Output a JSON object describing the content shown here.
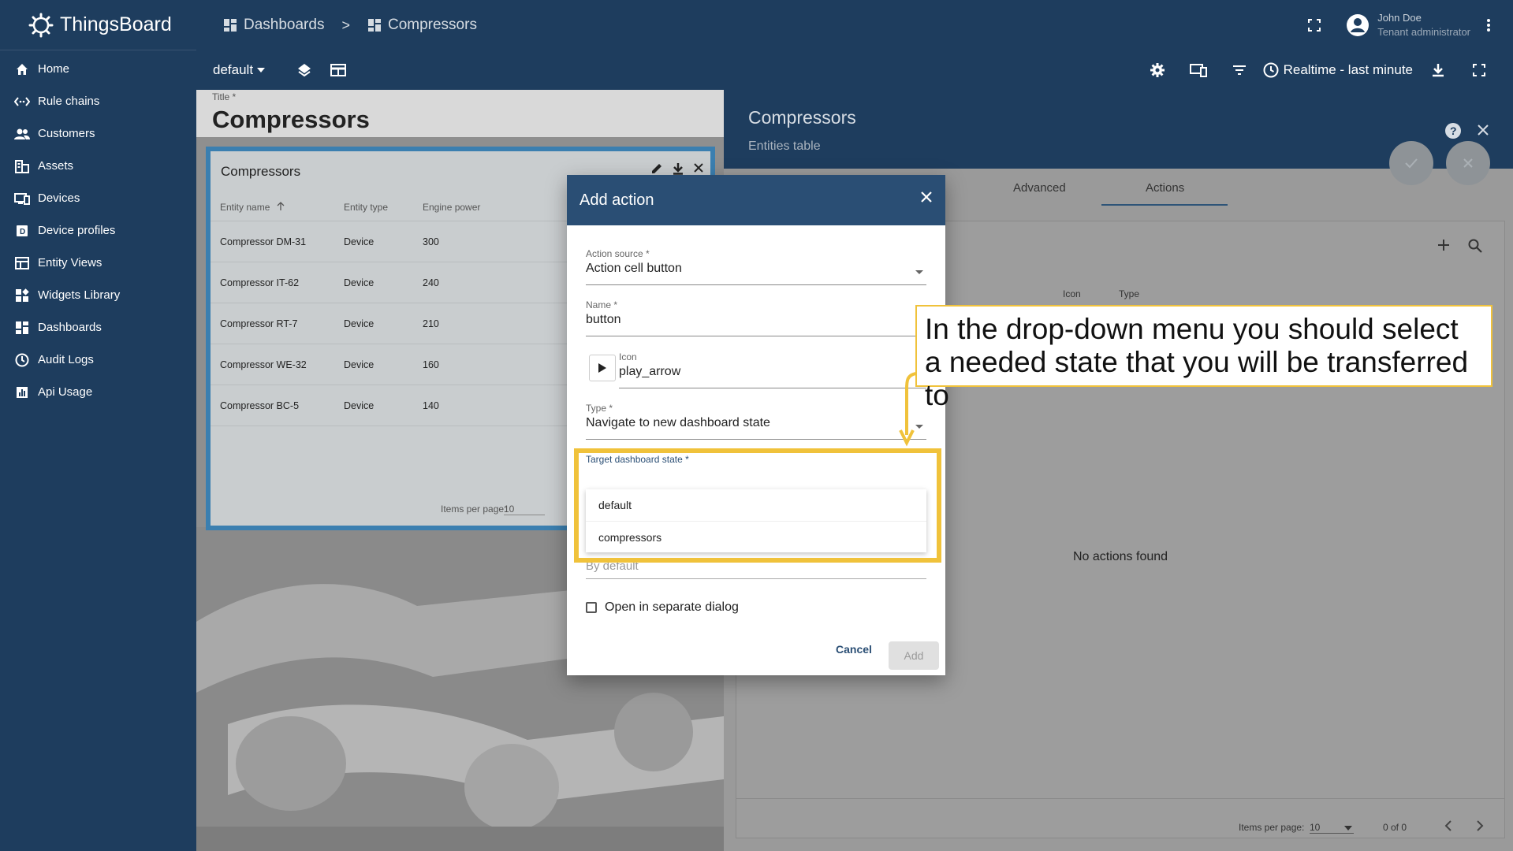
{
  "app": {
    "name": "ThingsBoard"
  },
  "sidebar": {
    "items": [
      {
        "label": "Home",
        "icon": "home-icon"
      },
      {
        "label": "Rule chains",
        "icon": "rule-chains-icon"
      },
      {
        "label": "Customers",
        "icon": "customers-icon"
      },
      {
        "label": "Assets",
        "icon": "assets-icon"
      },
      {
        "label": "Devices",
        "icon": "devices-icon"
      },
      {
        "label": "Device profiles",
        "icon": "device-profiles-icon"
      },
      {
        "label": "Entity Views",
        "icon": "entity-views-icon"
      },
      {
        "label": "Widgets Library",
        "icon": "widgets-library-icon"
      },
      {
        "label": "Dashboards",
        "icon": "dashboards-icon"
      },
      {
        "label": "Audit Logs",
        "icon": "audit-logs-icon"
      },
      {
        "label": "Api Usage",
        "icon": "api-usage-icon"
      }
    ]
  },
  "topbar": {
    "breadcrumb": [
      "Dashboards",
      "Compressors"
    ],
    "separator": ">",
    "user": {
      "name": "John Doe",
      "role": "Tenant administrator"
    }
  },
  "toolbar": {
    "state": "default",
    "timewindow": "Realtime - last minute"
  },
  "dashboard": {
    "title_label": "Title *",
    "title": "Compressors",
    "widget": {
      "title": "Compressors",
      "columns": [
        "Entity name",
        "Entity type",
        "Engine power"
      ],
      "rows": [
        {
          "name": "Compressor DM-31",
          "type": "Device",
          "power": "300"
        },
        {
          "name": "Compressor IT-62",
          "type": "Device",
          "power": "240"
        },
        {
          "name": "Compressor RT-7",
          "type": "Device",
          "power": "210"
        },
        {
          "name": "Compressor WE-32",
          "type": "Device",
          "power": "160"
        },
        {
          "name": "Compressor BC-5",
          "type": "Device",
          "power": "140"
        }
      ],
      "items_per_page_label": "Items per page:",
      "items_per_page": "10"
    }
  },
  "right_panel": {
    "title": "Compressors",
    "subtitle": "Entities table",
    "tabs": [
      "Advanced",
      "Actions"
    ],
    "columns": {
      "icon": "Icon",
      "type": "Type"
    },
    "empty": "No actions found",
    "items_per_page_label": "Items per page:",
    "items_per_page": "10",
    "range": "0 of 0"
  },
  "dialog": {
    "title": "Add action",
    "action_source": {
      "label": "Action source *",
      "value": "Action cell button"
    },
    "name": {
      "label": "Name *",
      "value": "button"
    },
    "icon": {
      "label": "Icon",
      "value": "play_arrow"
    },
    "type": {
      "label": "Type *",
      "value": "Navigate to new dashboard state"
    },
    "target": {
      "label": "Target dashboard state *",
      "value": ""
    },
    "options": [
      "default",
      "compressors"
    ],
    "params_placeholder": "By default",
    "separate_dialog": "Open in separate dialog",
    "cancel": "Cancel",
    "add": "Add"
  },
  "callout": {
    "line1": "In the drop-down menu you should select",
    "line2": "a needed state that you will be transferred to"
  },
  "colors": {
    "sidebar": "#1e3d5e",
    "dialog_header": "#2a4e74",
    "highlight": "#f0c23b"
  }
}
